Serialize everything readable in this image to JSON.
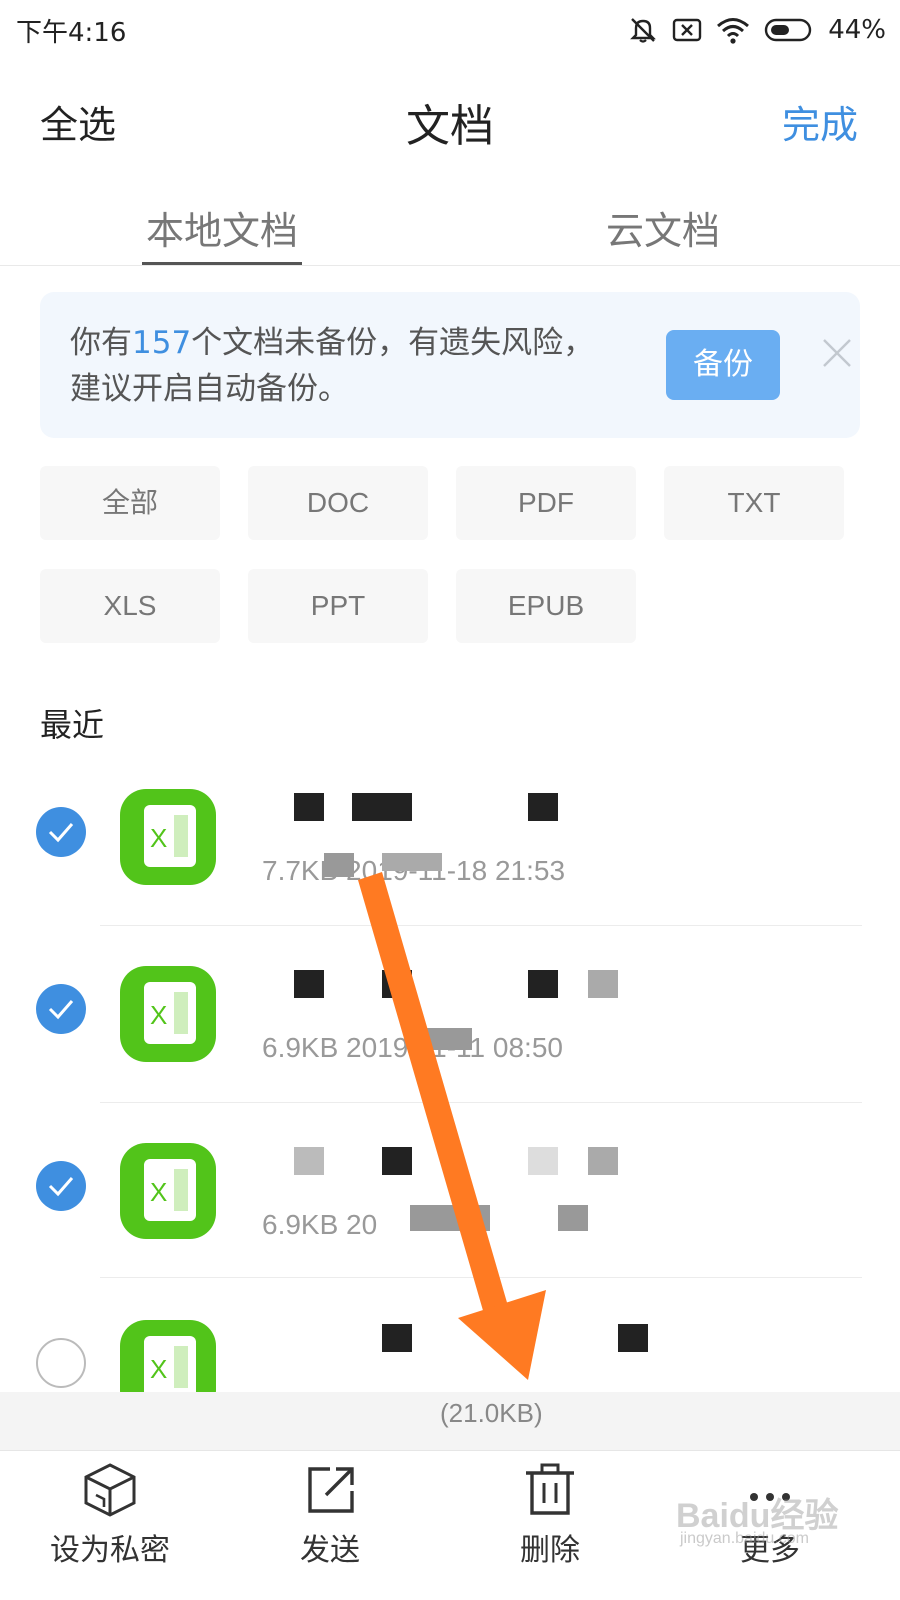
{
  "status_bar": {
    "time": "下午4:16",
    "battery": "44%",
    "icons": [
      "mute-bell-icon",
      "sim-off-icon",
      "wifi-icon",
      "battery-icon"
    ]
  },
  "header": {
    "select_all": "全选",
    "title": "文档",
    "done": "完成",
    "accent_color": "#3f8fe0"
  },
  "tabs": [
    {
      "label": "本地文档",
      "active": true
    },
    {
      "label": "云文档",
      "active": false
    }
  ],
  "banner": {
    "text_before": "你有",
    "count": "157",
    "text_after": "个文档未备份，有遗失风险，建议开启自动备份。",
    "button": "备份"
  },
  "filters": [
    "全部",
    "DOC",
    "PDF",
    "TXT",
    "XLS",
    "PPT",
    "EPUB"
  ],
  "recent_heading": "最近",
  "files": [
    {
      "checked": true,
      "meta": "7.7KB  2019-11-18 21:53",
      "icon": "excel-file-icon"
    },
    {
      "checked": true,
      "meta": "6.9KB  2019-11-11 08:50",
      "icon": "excel-file-icon"
    },
    {
      "checked": true,
      "meta": "6.9KB  20",
      "icon": "excel-file-icon"
    },
    {
      "checked": false,
      "meta": "",
      "icon": "excel-file-icon"
    }
  ],
  "selection_summary": "(21.0KB)",
  "toolbar": [
    {
      "label": "设为私密",
      "icon": "private-box-icon"
    },
    {
      "label": "发送",
      "icon": "share-icon"
    },
    {
      "label": "删除",
      "icon": "trash-icon"
    },
    {
      "label": "更多",
      "icon": "more-dots-icon"
    }
  ],
  "watermark": {
    "brand": "Baidu经验",
    "url": "jingyan.baidu.com"
  }
}
